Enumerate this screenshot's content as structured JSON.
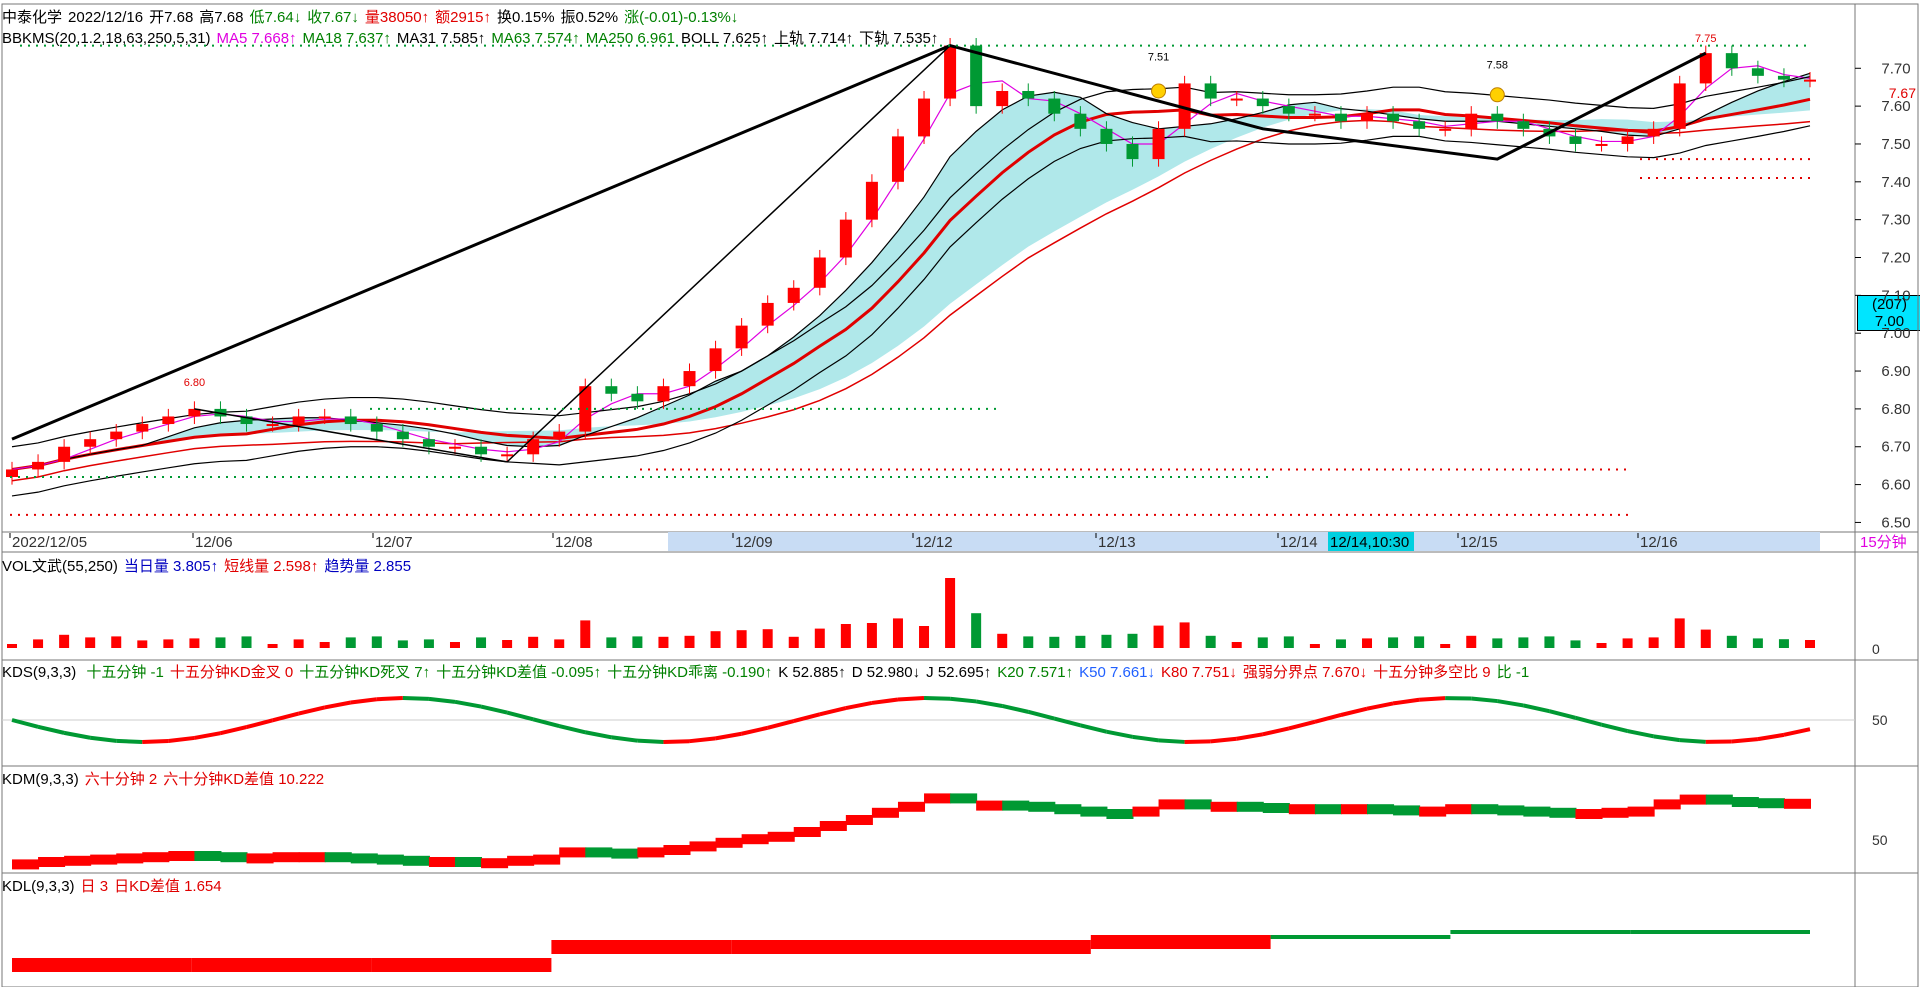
{
  "header": {
    "stock_name": "中泰化学",
    "date": "2022/12/16",
    "open": "开7.68",
    "high": "高7.68",
    "low": "低7.64↓",
    "close": "收7.67↓",
    "volume": "量38050↑",
    "amount": "额2915↑",
    "turnover": "换0.15%",
    "amplitude": "振0.52%",
    "change": "涨(-0.01)-0.13%↓"
  },
  "indicator_main": {
    "name": "BBKMS(20,1.2,18,63,250,5,31)",
    "ma5": "MA5 7.668↑",
    "ma18": "MA18 7.637↑",
    "ma31": "MA31 7.585↑",
    "ma63": "MA63 7.574↑",
    "ma250": "MA250 6.961",
    "boll": "BOLL 7.625↑",
    "upper": "上轨 7.714↑",
    "lower": "下轨 7.535↑"
  },
  "price_axis": {
    "ticks": [
      "7.70",
      "7.60",
      "7.50",
      "7.40",
      "7.30",
      "7.20",
      "7.10",
      "7.00",
      "6.90",
      "6.80",
      "6.70",
      "6.60",
      "6.50"
    ],
    "current_price": "7.67",
    "box_count": "(207)",
    "box_price": "7.00"
  },
  "annotations": {
    "peak_low_label": "6.80",
    "mid_label1": "7.51",
    "mid_label2": "7.58",
    "top_label": "7.75"
  },
  "time_axis": {
    "labels": [
      "2022/12/05",
      "12/06",
      "12/07",
      "12/08",
      "12/09",
      "12/12",
      "12/13",
      "12/14",
      "12/15",
      "12/16"
    ],
    "cursor_label": "12/14,10:30",
    "period": "15分钟"
  },
  "vol_panel": {
    "name": "VOL文武(55,250)",
    "today": "当日量 3.805↑",
    "short": "短线量 2.598↑",
    "trend": "趋势量 2.855",
    "axis_zero": "0"
  },
  "kds_panel": {
    "name": "KDS(9,3,3)",
    "items": [
      "十五分钟 -1",
      "十五分钟KD金叉 0",
      "十五分钟KD死叉 7↑",
      "十五分钟KD差值 -0.095↑",
      "十五分钟KD乖离 -0.190↑",
      "K 52.885↑",
      "D 52.980↓",
      "J 52.695↑",
      "K20 7.571↑",
      "K50 7.661↓",
      "K80 7.751↓",
      "强弱分界点 7.670↓",
      "十五分钟多空比 9",
      "比 -1"
    ],
    "axis_50": "50"
  },
  "kdm_panel": {
    "name": "KDM(9,3,3)",
    "items": [
      "六十分钟 2",
      "六十分钟KD差值 10.222"
    ],
    "axis_50": "50"
  },
  "kdl_panel": {
    "name": "KDL(9,3,3)",
    "items": [
      "日 3",
      "日KD差值 1.654"
    ]
  },
  "colors": {
    "up": "#ff0000",
    "down": "#009933",
    "cloud": "#b0e8ea",
    "cursor": "#00d0e0",
    "axisband": "#c8dcf4"
  },
  "chart_data": {
    "type": "candlestick",
    "title": "",
    "ylim": [
      6.48,
      7.78
    ],
    "session_days": [
      "12/05",
      "12/06",
      "12/07",
      "12/08",
      "12/09",
      "12/12",
      "12/13",
      "12/14",
      "12/15",
      "12/16"
    ],
    "close_series": [
      6.64,
      6.66,
      6.7,
      6.72,
      6.74,
      6.76,
      6.78,
      6.8,
      6.78,
      6.76,
      6.76,
      6.78,
      6.78,
      6.76,
      6.74,
      6.72,
      6.7,
      6.7,
      6.68,
      6.68,
      6.72,
      6.74,
      6.86,
      6.84,
      6.82,
      6.86,
      6.9,
      6.96,
      7.02,
      7.08,
      7.12,
      7.2,
      7.3,
      7.4,
      7.52,
      7.62,
      7.76,
      7.6,
      7.64,
      7.62,
      7.58,
      7.54,
      7.5,
      7.46,
      7.54,
      7.66,
      7.62,
      7.62,
      7.6,
      7.58,
      7.58,
      7.56,
      7.58,
      7.56,
      7.54,
      7.54,
      7.58,
      7.56,
      7.54,
      7.52,
      7.5,
      7.5,
      7.52,
      7.54,
      7.66,
      7.74,
      7.7,
      7.68,
      7.67,
      7.67
    ]
  }
}
